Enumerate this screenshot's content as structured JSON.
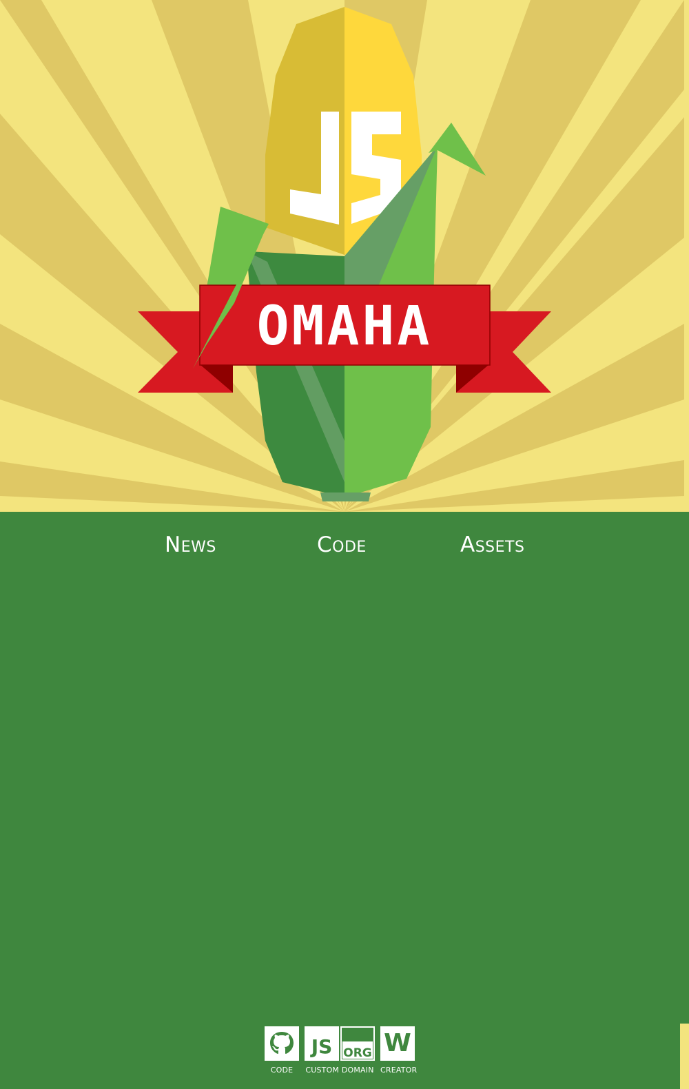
{
  "hero": {
    "logo_alt": "OmahaJS corn logo",
    "logo_mark": "JS",
    "banner_text": "OMAHA"
  },
  "nav": {
    "items": [
      {
        "label": "News"
      },
      {
        "label": "Code"
      },
      {
        "label": "Assets"
      }
    ]
  },
  "footer": {
    "items": [
      {
        "label": "CODE",
        "icon": "github-icon"
      },
      {
        "label": "CUSTOM DOMAIN",
        "icon": "js-org-icon",
        "js_text": "JS",
        "org_text": "ORG"
      },
      {
        "label": "CREATOR",
        "icon": "w-letter-icon",
        "letter": "W"
      }
    ]
  },
  "colors": {
    "sky_light": "#f3e47e",
    "sky_ray": "#dfc865",
    "green_bg": "#3f873e",
    "corn_yellow_dark": "#d8bc35",
    "corn_yellow_light": "#fed83c",
    "husk_dark": "#3d8a3f",
    "husk_light": "#6fc04a",
    "husk_mid": "#669f66",
    "ribbon_red": "#d71921",
    "ribbon_shadow": "#8f0000",
    "text_white": "#ffffff"
  }
}
